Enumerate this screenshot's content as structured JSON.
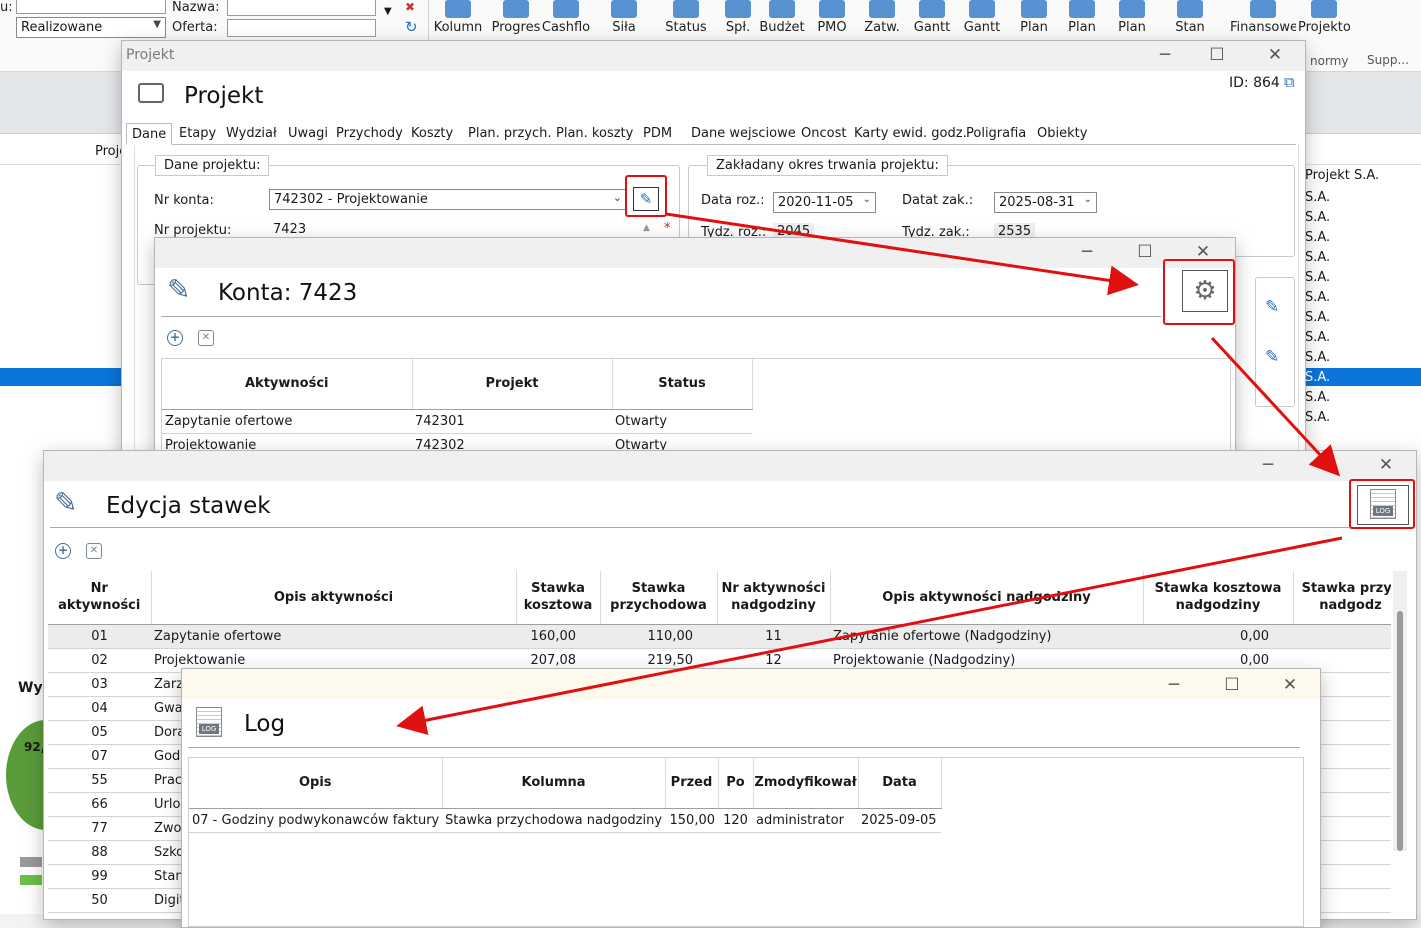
{
  "ribbon": {
    "left_labels": {
      "u": "u:",
      "nazwa": "Nazwa:",
      "oferta": "Oferta:"
    },
    "status_combo": "Realizowane",
    "buttons": [
      "Kolumn",
      "Progres",
      "Cashflo",
      "Siła",
      "Status",
      "Spł.",
      "Budżet",
      "PMO",
      "Zatw.",
      "Gantt",
      "Gantt",
      "Plan",
      "Plan",
      "Plan",
      "Stan",
      "Finansowe",
      "Projekto..."
    ],
    "sub_labels": {
      "normy": "normy",
      "supp": "Supp..."
    }
  },
  "background": {
    "col_header": "Proje",
    "right_col": [
      "Projekt S.A.",
      "S.A.",
      "S.A.",
      "S.A.",
      "S.A.",
      "S.A.",
      "S.A.",
      "S.A.",
      "S.A.",
      "S.A.",
      "S.A.",
      "S.A.",
      "S.A."
    ],
    "left_label": "Wyk",
    "pie_value": "92,"
  },
  "projekt": {
    "window_title": "Projekt",
    "title": "Projekt",
    "id_label": "ID: 864",
    "tabs": [
      "Dane",
      "Etapy",
      "Wydział",
      "Uwagi",
      "Przychody",
      "Koszty",
      "Plan. przych.",
      "Plan. koszty",
      "PDM",
      "Dane wejsciowe",
      "Oncost",
      "Karty ewid. godz.",
      "Poligrafia",
      "Obiekty"
    ],
    "group1": "Dane projektu:",
    "nr_konta_label": "Nr konta:",
    "nr_konta_value": "742302 - Projektowanie",
    "nr_projektu_label": "Nr projektu:",
    "nr_projektu_value": "7423",
    "required_mark": "*",
    "group2": "Zakładany okres trwania projektu:",
    "data_roz_label": "Data roz.:",
    "data_roz_value": "2020-11-05",
    "data_zak_label": "Datat zak.:",
    "data_zak_value": "2025-08-31",
    "tydz_roz_label": "Tydz. roz.:",
    "tydz_roz_value": "2045",
    "tydz_zak_label": "Tydz. zak.:",
    "tydz_zak_value": "2535"
  },
  "konta": {
    "title": "Konta: 7423",
    "columns": [
      "Aktywności",
      "Projekt",
      "Status"
    ],
    "rows": [
      {
        "akt": "Zapytanie ofertowe",
        "projekt": "742301",
        "status": "Otwarty"
      },
      {
        "akt": "Projektowanie",
        "projekt": "742302",
        "status": "Otwarty"
      }
    ]
  },
  "stawki": {
    "title": "Edycja stawek",
    "columns": [
      "Nr aktywności",
      "Opis aktywności",
      "Stawka kosztowa",
      "Stawka przychodowa",
      "Nr aktywności nadgodziny",
      "Opis aktywności nadgodziny",
      "Stawka kosztowa nadgodziny",
      "Stawka przyc nadgodz"
    ],
    "rows": [
      {
        "nr": "01",
        "opis": "Zapytanie ofertowe",
        "sk": "160,00",
        "sp": "110,00",
        "nrn": "11",
        "opisn": "Zapytanie ofertowe (Nadgodziny)",
        "skn": "0,00"
      },
      {
        "nr": "02",
        "opis": "Projektowanie",
        "sk": "207,08",
        "sp": "219,50",
        "nrn": "12",
        "opisn": "Projektowanie (Nadgodziny)",
        "skn": "0,00"
      },
      {
        "nr": "03",
        "opis": "Zarz"
      },
      {
        "nr": "04",
        "opis": "Gwa"
      },
      {
        "nr": "05",
        "opis": "Dora"
      },
      {
        "nr": "07",
        "opis": "God"
      },
      {
        "nr": "55",
        "opis": "Prac"
      },
      {
        "nr": "66",
        "opis": "Urlo"
      },
      {
        "nr": "77",
        "opis": "Zwo"
      },
      {
        "nr": "88",
        "opis": "Szko"
      },
      {
        "nr": "99",
        "opis": "Stan"
      },
      {
        "nr": "50",
        "opis": "Digit"
      }
    ]
  },
  "log": {
    "title": "Log",
    "icon_text": "LOG",
    "columns": [
      "Opis",
      "Kolumna",
      "Przed",
      "Po",
      "Zmodyfikował",
      "Data"
    ],
    "rows": [
      {
        "opis": "07 - Godziny podwykonawców faktury",
        "kolumna": "Stawka przychodowa nadgodziny",
        "przed": "150,00",
        "po": "120",
        "user": "administrator",
        "data": "2025-09-05"
      }
    ]
  },
  "colors": {
    "highlight": "#e01010",
    "selection": "#0a74d9",
    "accent": "#3b7ec9"
  }
}
